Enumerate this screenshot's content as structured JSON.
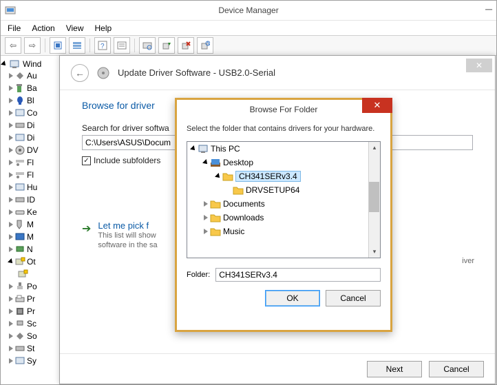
{
  "dm": {
    "title": "Device Manager",
    "menus": [
      "File",
      "Action",
      "View",
      "Help"
    ],
    "tree": {
      "root": "Wind",
      "nodes": [
        "Au",
        "Ba",
        "Bl",
        "Co",
        "Di",
        "Di",
        "DV",
        "Fl",
        "Fl",
        "Hu",
        "ID",
        "Ke",
        "M",
        "M",
        "N",
        "Ot",
        "Po",
        "Pr",
        "Pr",
        "Sc",
        "So",
        "St",
        "Sy"
      ]
    }
  },
  "wizard": {
    "title": "Update Driver Software - USB2.0-Serial",
    "heading_visible": "Browse for driver",
    "search_label_visible": "Search for driver softwa",
    "path_visible": "C:\\Users\\ASUS\\Docum",
    "include_subfolders": "Include subfolders",
    "pick_title_visible": "Let me pick f",
    "pick_sub1_visible": "This list will show",
    "pick_sub2_visible": "software in the sa",
    "pick_right_visible": "iver",
    "next": "Next",
    "cancel": "Cancel"
  },
  "bff": {
    "title": "Browse For Folder",
    "message": "Select the folder that contains drivers for your hardware.",
    "tree": {
      "root": "This PC",
      "desktop": "Desktop",
      "selected": "CH341SERv3.4",
      "child": "DRVSETUP64",
      "siblings": [
        "Documents",
        "Downloads",
        "Music"
      ]
    },
    "folder_label": "Folder:",
    "folder_value": "CH341SERv3.4",
    "ok": "OK",
    "cancel": "Cancel"
  }
}
